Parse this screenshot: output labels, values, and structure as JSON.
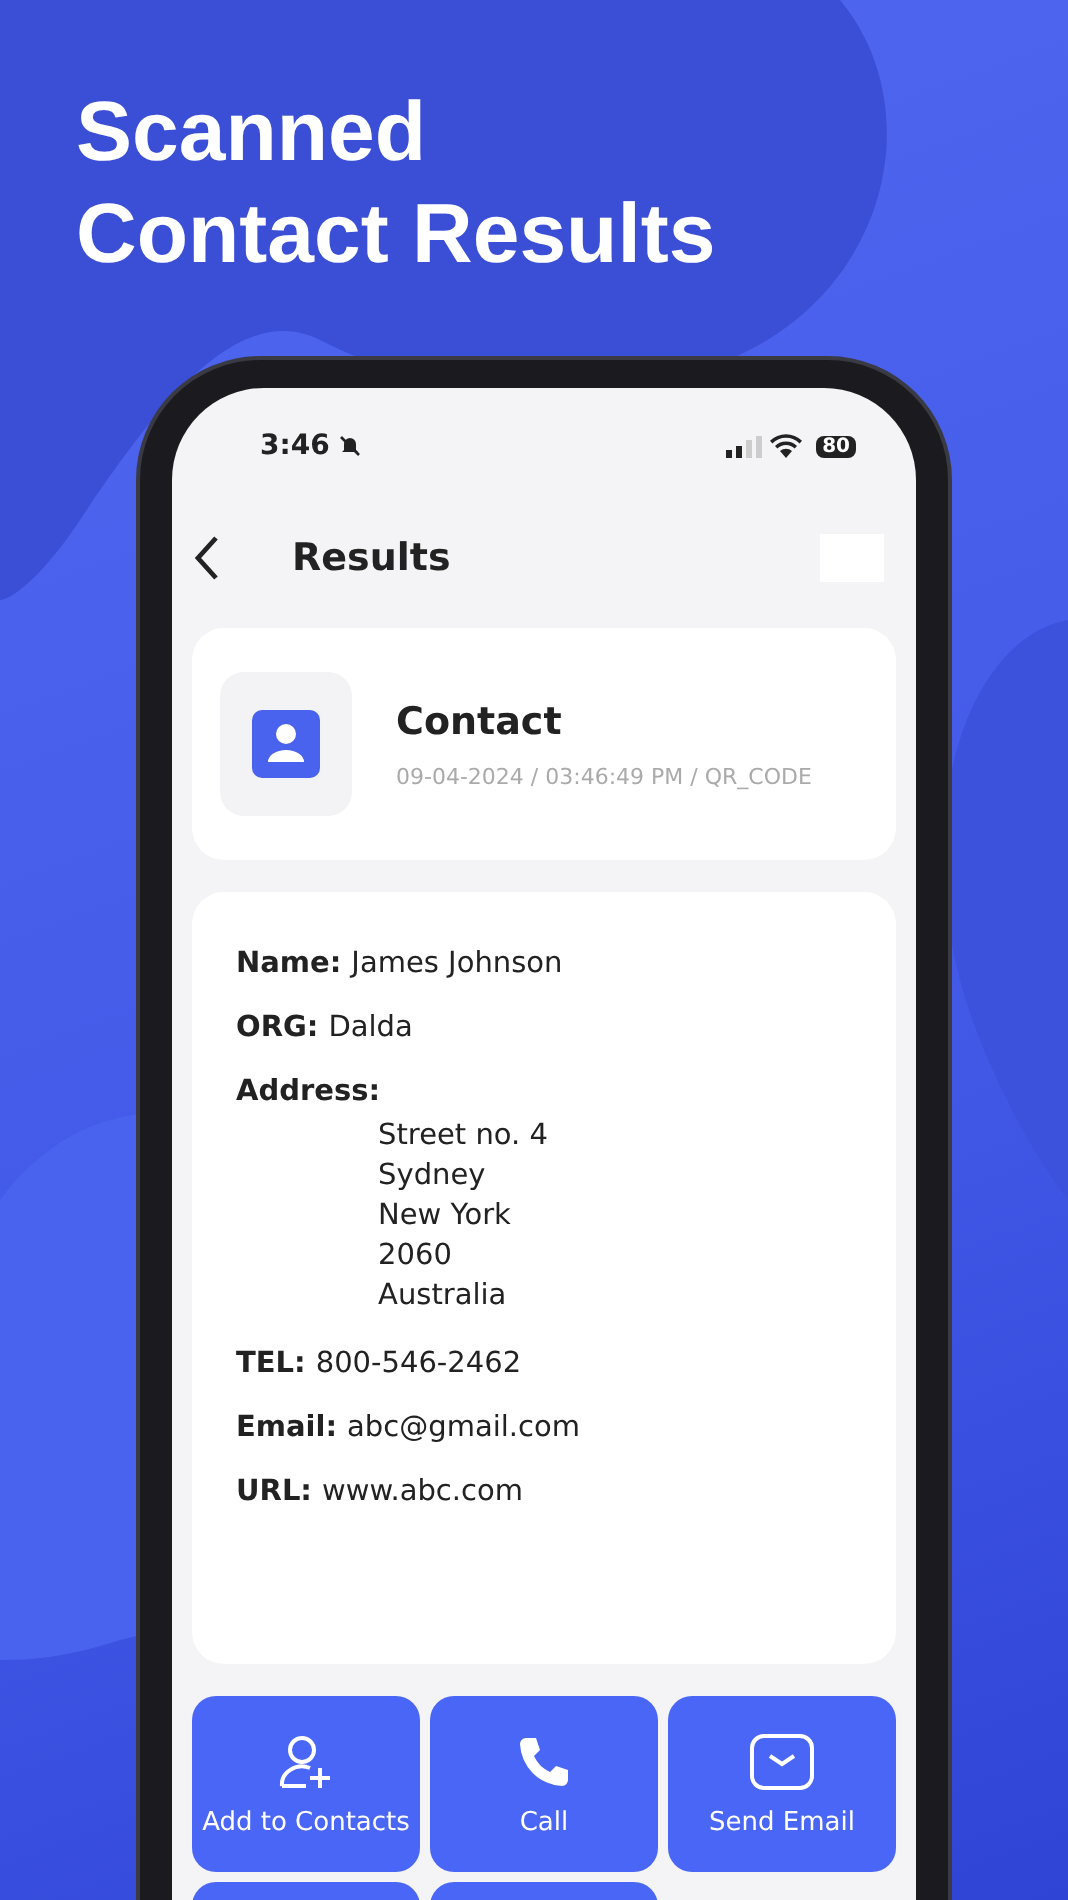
{
  "headline": [
    "Scanned",
    "Contact Results"
  ],
  "status_bar": {
    "time": "3:46",
    "silent": true,
    "battery": "80"
  },
  "header": {
    "title": "Results"
  },
  "summary": {
    "type": "Contact",
    "meta": "09-04-2024 / 03:46:49 PM / QR_CODE"
  },
  "fields": [
    {
      "label": "Name:",
      "value": "James Johnson"
    },
    {
      "label": "ORG:",
      "value": "Dalda"
    },
    {
      "label": "Address:",
      "lines": [
        "Street no. 4",
        "Sydney",
        "New York",
        "2060",
        "Australia"
      ]
    },
    {
      "label": "TEL:",
      "value": "800-546-2462"
    },
    {
      "label": "Email:",
      "value": "abc@gmail.com"
    },
    {
      "label": "URL:",
      "value": "www.abc.com"
    }
  ],
  "actions": [
    {
      "kind": "add-contact",
      "label": "Add to Contacts"
    },
    {
      "kind": "call",
      "label": "Call"
    },
    {
      "kind": "email",
      "label": "Send Email"
    },
    {
      "kind": "cut"
    },
    {
      "kind": "cut"
    }
  ]
}
